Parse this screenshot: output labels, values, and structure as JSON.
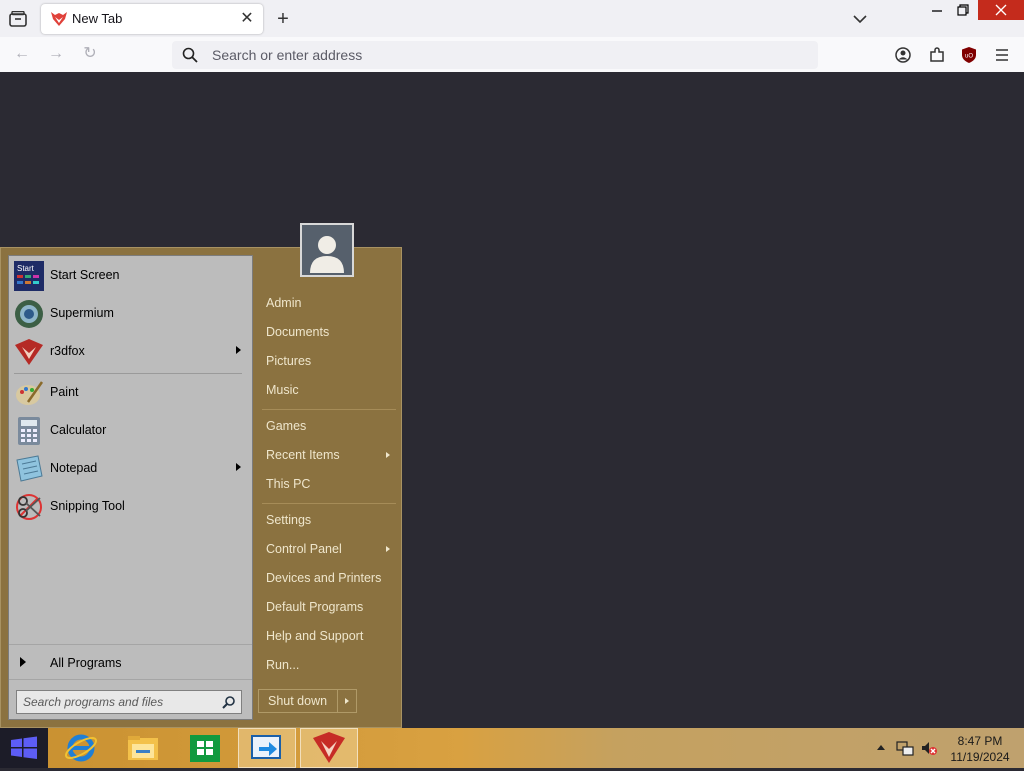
{
  "browser": {
    "tab_title": "New Tab",
    "url_placeholder": "Search or enter address"
  },
  "start_menu": {
    "programs": [
      {
        "label": "Start Screen",
        "icon": "start-screen-icon",
        "submenu": false
      },
      {
        "label": "Supermium",
        "icon": "supermium-icon",
        "submenu": false
      },
      {
        "label": "r3dfox",
        "icon": "r3dfox-icon",
        "submenu": true
      },
      {
        "label": "Paint",
        "icon": "paint-icon",
        "submenu": false
      },
      {
        "label": "Calculator",
        "icon": "calculator-icon",
        "submenu": false
      },
      {
        "label": "Notepad",
        "icon": "notepad-icon",
        "submenu": true
      },
      {
        "label": "Snipping Tool",
        "icon": "snipping-tool-icon",
        "submenu": false
      }
    ],
    "all_programs": "All Programs",
    "search_placeholder": "Search programs and files",
    "right_links": [
      {
        "label": "Admin",
        "submenu": false
      },
      {
        "label": "Documents",
        "submenu": false
      },
      {
        "label": "Pictures",
        "submenu": false
      },
      {
        "label": "Music",
        "submenu": false
      },
      {
        "label": "Games",
        "submenu": false
      },
      {
        "label": "Recent Items",
        "submenu": true
      },
      {
        "label": "This PC",
        "submenu": false
      },
      {
        "label": "Settings",
        "submenu": false
      },
      {
        "label": "Control Panel",
        "submenu": true
      },
      {
        "label": "Devices and Printers",
        "submenu": false
      },
      {
        "label": "Default Programs",
        "submenu": false
      },
      {
        "label": "Help and Support",
        "submenu": false
      },
      {
        "label": "Run...",
        "submenu": false
      }
    ],
    "shutdown": "Shut down"
  },
  "taskbar": {
    "pinned": [
      "internet-explorer-icon",
      "file-explorer-icon",
      "store-icon",
      "remote-desktop-icon",
      "r3dfox-icon"
    ],
    "time": "8:47 PM",
    "date": "11/19/2024"
  },
  "colors": {
    "start_menu_bg": "#8b7240",
    "left_pane_bg": "#bcbcbc",
    "desktop_bg": "#2b2a33",
    "close_button": "#c42b1c"
  }
}
